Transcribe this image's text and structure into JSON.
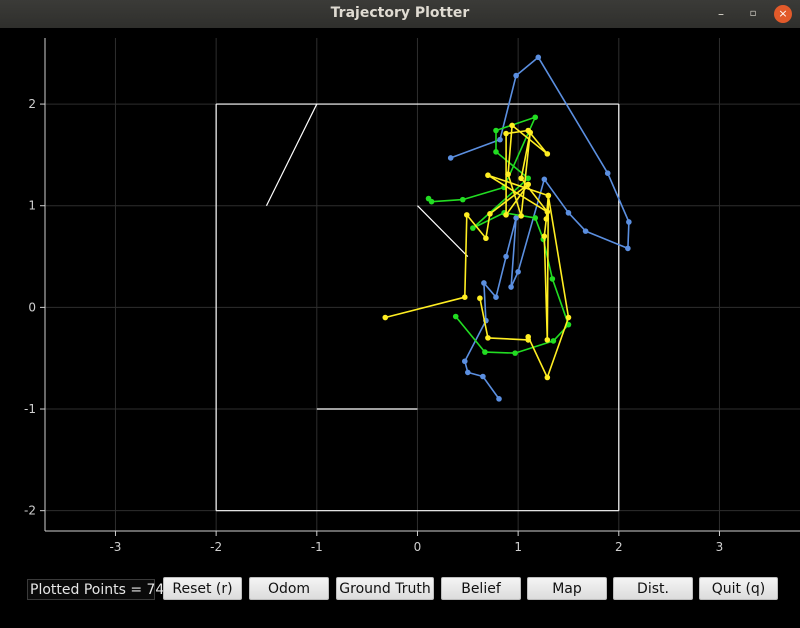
{
  "window": {
    "title": "Trajectory Plotter",
    "controls": {
      "minimize": "–",
      "maximize": "▫",
      "close": "×"
    }
  },
  "status": {
    "text": "Plotted Points = 74"
  },
  "buttons": {
    "reset": "Reset (r)",
    "odom": "Odom",
    "ground_truth": "Ground Truth",
    "belief": "Belief",
    "map": "Map",
    "dist": "Dist.",
    "quit": "Quit (q)"
  },
  "chart_data": {
    "type": "line",
    "xlim": [
      -3.7,
      3.8
    ],
    "ylim": [
      -2.2,
      2.65
    ],
    "grid": true,
    "xticks": [
      "-3",
      "-2",
      "-1",
      "0",
      "1",
      "2",
      "3"
    ],
    "yticks": [
      "2",
      "1",
      "0",
      "-1",
      "-2"
    ],
    "background": "#000000",
    "map_color": "#ffffff",
    "map_segments": [
      [
        [
          -2,
          2
        ],
        [
          2,
          2
        ]
      ],
      [
        [
          2,
          2
        ],
        [
          2,
          -2
        ]
      ],
      [
        [
          2,
          -2
        ],
        [
          -2,
          -2
        ]
      ],
      [
        [
          -2,
          -2
        ],
        [
          -2,
          2
        ]
      ],
      [
        [
          -1,
          2
        ],
        [
          -1.5,
          1
        ]
      ],
      [
        [
          -1,
          -1
        ],
        [
          0,
          -1
        ]
      ],
      [
        [
          0,
          1
        ],
        [
          0.5,
          0.5
        ]
      ]
    ],
    "series": [
      {
        "color": "#5b8fe0",
        "points": [
          [
            0.33,
            1.47
          ],
          [
            0.82,
            1.65
          ],
          [
            0.98,
            2.28
          ],
          [
            1.2,
            2.46
          ],
          [
            1.89,
            1.32
          ],
          [
            2.1,
            0.84
          ],
          [
            2.09,
            0.58
          ],
          [
            1.67,
            0.75
          ],
          [
            1.5,
            0.93
          ],
          [
            1.26,
            1.26
          ],
          [
            1.0,
            0.35
          ],
          [
            0.93,
            0.2
          ],
          [
            0.98,
            0.88
          ],
          [
            0.88,
            0.5
          ],
          [
            0.78,
            0.1
          ],
          [
            0.66,
            0.24
          ],
          [
            0.68,
            -0.13
          ],
          [
            0.47,
            -0.53
          ],
          [
            0.5,
            -0.64
          ],
          [
            0.65,
            -0.68
          ],
          [
            0.81,
            -0.9
          ]
        ]
      },
      {
        "color": "#22dd22",
        "points": [
          [
            0.11,
            1.07
          ],
          [
            0.14,
            1.04
          ],
          [
            0.45,
            1.06
          ],
          [
            0.86,
            1.18
          ],
          [
            1.17,
            1.87
          ],
          [
            0.78,
            1.74
          ],
          [
            0.78,
            1.53
          ],
          [
            1.1,
            1.27
          ],
          [
            0.55,
            0.78
          ],
          [
            0.86,
            0.93
          ],
          [
            1.17,
            0.88
          ],
          [
            1.25,
            0.67
          ],
          [
            1.34,
            0.28
          ],
          [
            1.5,
            -0.17
          ],
          [
            1.35,
            -0.33
          ],
          [
            0.97,
            -0.45
          ],
          [
            0.67,
            -0.44
          ],
          [
            0.38,
            -0.09
          ]
        ]
      },
      {
        "color": "#ffee22",
        "points": [
          [
            -0.32,
            -0.1
          ],
          [
            0.47,
            0.1
          ],
          [
            0.49,
            0.91
          ],
          [
            0.68,
            0.68
          ],
          [
            0.72,
            0.92
          ],
          [
            1.1,
            1.21
          ],
          [
            0.88,
            0.91
          ],
          [
            0.88,
            1.71
          ],
          [
            1.1,
            1.74
          ],
          [
            1.29,
            1.51
          ],
          [
            0.94,
            1.79
          ],
          [
            0.9,
            1.31
          ],
          [
            1.03,
            0.9
          ],
          [
            1.12,
            1.72
          ],
          [
            1.03,
            1.27
          ],
          [
            1.29,
            0.94
          ],
          [
            0.7,
            1.3
          ],
          [
            1.3,
            1.1
          ],
          [
            1.28,
            0.87
          ],
          [
            1.26,
            0.7
          ],
          [
            1.29,
            -0.32
          ],
          [
            1.3,
            1.1
          ],
          [
            1.5,
            -0.1
          ],
          [
            1.29,
            -0.69
          ],
          [
            1.1,
            -0.29
          ],
          [
            1.1,
            -0.32
          ],
          [
            0.7,
            -0.3
          ],
          [
            0.62,
            0.09
          ]
        ]
      }
    ]
  }
}
